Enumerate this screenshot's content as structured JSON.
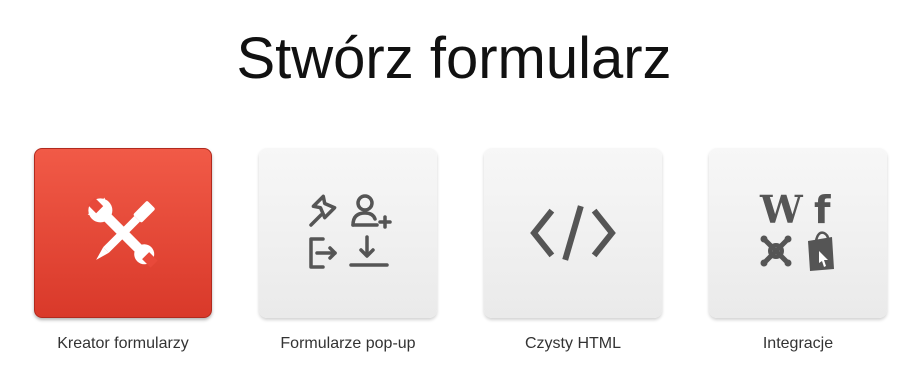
{
  "header": {
    "title": "Stwórz formularz"
  },
  "options": [
    {
      "label": "Kreator formularzy",
      "icon": "tools-icon",
      "active": true,
      "color": "#e8493a"
    },
    {
      "label": "Formularze pop-up",
      "icon": "popup-form-icons",
      "active": false
    },
    {
      "label": "Czysty HTML",
      "icon": "code-icon",
      "active": false
    },
    {
      "label": "Integracje",
      "icon": "integrations-icons",
      "active": false,
      "logo_text": {
        "wordpress": "W",
        "facebook": "f"
      }
    }
  ],
  "colors": {
    "accent": "#e8493a",
    "icon_gray": "#555555",
    "tile_gray": "#f0f0f0",
    "title_text": "#111111",
    "label_text": "#333333"
  }
}
